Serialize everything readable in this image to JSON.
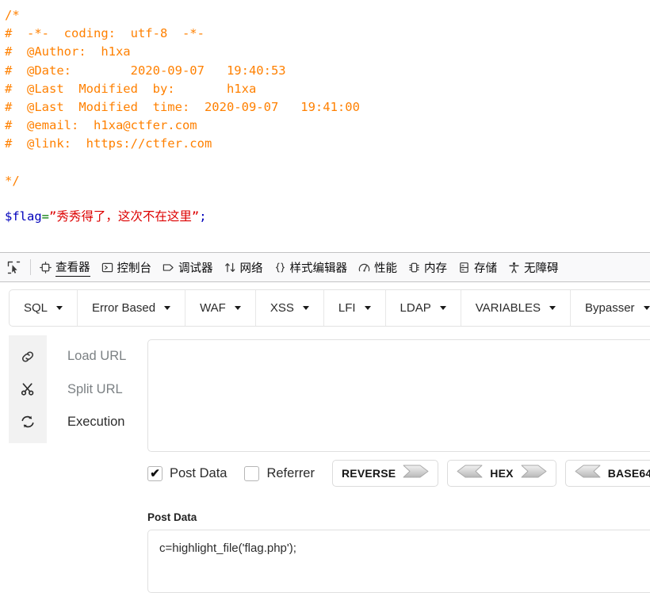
{
  "php_source": {
    "comment_lines": [
      "/*",
      "#  -*-  coding:  utf-8  -*-",
      "#  @Author:  h1xa",
      "#  @Date:        2020-09-07   19:40:53",
      "#  @Last  Modified  by:       h1xa",
      "#  @Last  Modified  time:  2020-09-07   19:41:00",
      "#  @email:  h1xa@ctfer.com",
      "#  @link:  https://ctfer.com",
      "",
      "*/"
    ],
    "flag_statement": {
      "variable": "$flag",
      "operator": "=",
      "string": "”秀秀得了，这次不在这里”",
      "terminator": ";"
    },
    "colors": {
      "comment": "#FF8000",
      "variable": "#0000BB",
      "string": "#DD0000",
      "operator": "#007700"
    }
  },
  "devtools": {
    "picker_icon": "element-picker-icon",
    "tabs": [
      {
        "label": "查看器",
        "icon": "inspector-icon",
        "active": true
      },
      {
        "label": "控制台",
        "icon": "console-icon",
        "active": false
      },
      {
        "label": "调试器",
        "icon": "debugger-icon",
        "active": false
      },
      {
        "label": "网络",
        "icon": "network-icon",
        "active": false
      },
      {
        "label": "样式编辑器",
        "icon": "style-editor-icon",
        "active": false
      },
      {
        "label": "性能",
        "icon": "performance-icon",
        "active": false
      },
      {
        "label": "内存",
        "icon": "memory-icon",
        "active": false
      },
      {
        "label": "存储",
        "icon": "storage-icon",
        "active": false
      },
      {
        "label": "无障碍",
        "icon": "accessibility-icon",
        "active": false
      }
    ]
  },
  "hackbar": {
    "menus": [
      {
        "label": "SQL"
      },
      {
        "label": "Error Based"
      },
      {
        "label": "WAF"
      },
      {
        "label": "XSS"
      },
      {
        "label": "LFI"
      },
      {
        "label": "LDAP"
      },
      {
        "label": "VARIABLES"
      },
      {
        "label": "Bypasser"
      }
    ],
    "actions": [
      {
        "label": "Load URL",
        "icon": "link-icon"
      },
      {
        "label": "Split URL",
        "icon": "scissors-icon"
      },
      {
        "label": "Execution",
        "icon": "refresh-icon"
      }
    ],
    "url_field": {
      "value": "",
      "placeholder": ""
    },
    "options": {
      "post_data": {
        "label": "Post Data",
        "checked": true,
        "tick": "✔"
      },
      "referrer": {
        "label": "Referrer",
        "checked": false,
        "tick": ""
      }
    },
    "converters": [
      {
        "label": "REVERSE",
        "left_arrow": false,
        "right_arrow": true
      },
      {
        "label": "HEX",
        "left_arrow": true,
        "right_arrow": true
      },
      {
        "label": "BASE64",
        "left_arrow": true,
        "right_arrow": true
      }
    ],
    "post_data_section": {
      "label": "Post Data",
      "value": "c=highlight_file('flag.php');"
    }
  }
}
